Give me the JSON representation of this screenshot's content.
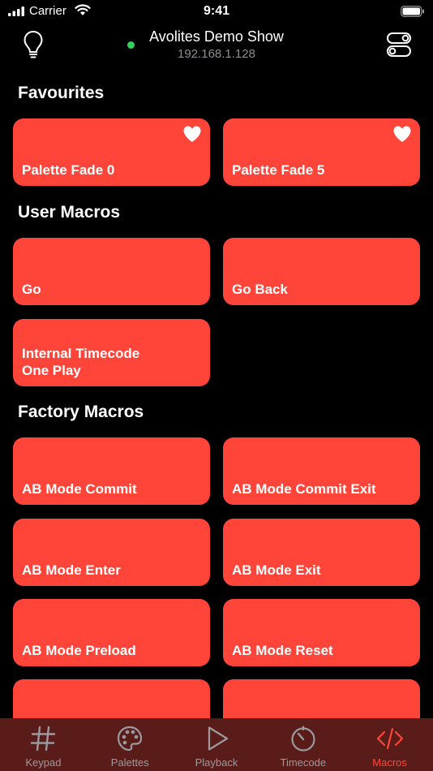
{
  "status": {
    "carrier": "Carrier",
    "time": "9:41"
  },
  "header": {
    "show_name": "Avolites Demo Show",
    "ip": "192.168.1.128",
    "connected_color": "#30d158"
  },
  "sections": {
    "favourites": {
      "title": "Favourites",
      "tiles": [
        {
          "label": "Palette Fade 0",
          "favourite": true
        },
        {
          "label": "Palette Fade 5",
          "favourite": true
        }
      ]
    },
    "user_macros": {
      "title": "User Macros",
      "tiles": [
        {
          "label": "Go"
        },
        {
          "label": "Go Back"
        },
        {
          "label": "Internal Timecode\nOne Play"
        }
      ]
    },
    "factory_macros": {
      "title": "Factory Macros",
      "tiles": [
        {
          "label": "AB Mode Commit"
        },
        {
          "label": "AB Mode Commit Exit"
        },
        {
          "label": "AB Mode Enter"
        },
        {
          "label": "AB Mode Exit"
        },
        {
          "label": "AB Mode Preload"
        },
        {
          "label": "AB Mode Reset"
        },
        {
          "label": ""
        },
        {
          "label": ""
        }
      ]
    }
  },
  "tabs": [
    {
      "label": "Keypad",
      "icon": "hash-icon"
    },
    {
      "label": "Palettes",
      "icon": "palette-icon"
    },
    {
      "label": "Playback",
      "icon": "play-icon"
    },
    {
      "label": "Timecode",
      "icon": "timer-icon"
    },
    {
      "label": "Macros",
      "icon": "code-icon",
      "active": true
    }
  ],
  "colors": {
    "accent": "#ff453a",
    "tabbar_bg": "#5a1c19",
    "inactive_tab": "#9a9aa0"
  }
}
